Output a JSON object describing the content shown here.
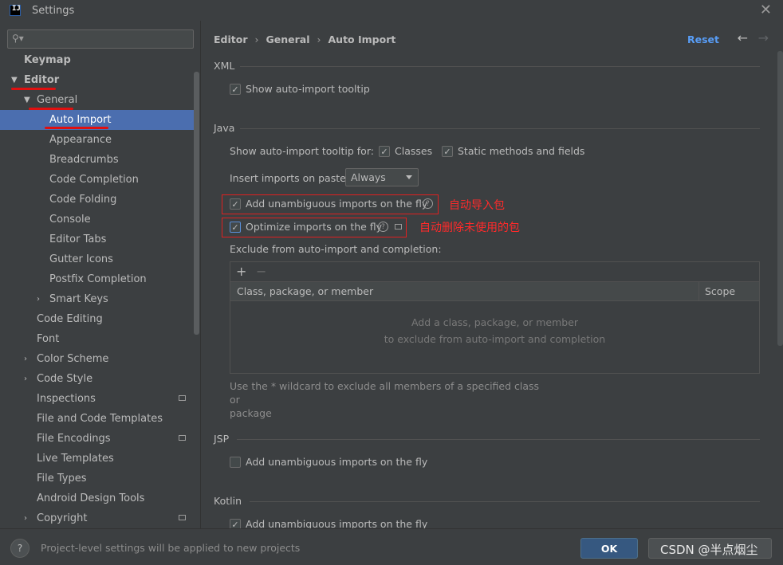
{
  "window": {
    "title": "Settings",
    "app_icon_text": "IJ"
  },
  "sidebar": {
    "search_placeholder": "",
    "items": [
      {
        "label": "Keymap"
      },
      {
        "label": "Editor"
      },
      {
        "label": "General"
      },
      {
        "label": "Auto Import"
      },
      {
        "label": "Appearance"
      },
      {
        "label": "Breadcrumbs"
      },
      {
        "label": "Code Completion"
      },
      {
        "label": "Code Folding"
      },
      {
        "label": "Console"
      },
      {
        "label": "Editor Tabs"
      },
      {
        "label": "Gutter Icons"
      },
      {
        "label": "Postfix Completion"
      },
      {
        "label": "Smart Keys"
      },
      {
        "label": "Code Editing"
      },
      {
        "label": "Font"
      },
      {
        "label": "Color Scheme"
      },
      {
        "label": "Code Style"
      },
      {
        "label": "Inspections"
      },
      {
        "label": "File and Code Templates"
      },
      {
        "label": "File Encodings"
      },
      {
        "label": "Live Templates"
      },
      {
        "label": "File Types"
      },
      {
        "label": "Android Design Tools"
      },
      {
        "label": "Copyright"
      }
    ]
  },
  "header": {
    "breadcrumb": [
      "Editor",
      "General",
      "Auto Import"
    ],
    "reset_label": "Reset"
  },
  "xml": {
    "title": "XML",
    "show_tooltip_label": "Show auto-import tooltip"
  },
  "java": {
    "title": "Java",
    "show_tooltip_for_label": "Show auto-import tooltip for:",
    "classes_label": "Classes",
    "static_label": "Static methods and fields",
    "insert_on_paste_label": "Insert imports on paste:",
    "insert_on_paste_value": "Always",
    "add_unambiguous_label": "Add unambiguous imports on the fly",
    "optimize_label": "Optimize imports on the fly",
    "exclude_label": "Exclude from auto-import and completion:",
    "table": {
      "columns": [
        "Class, package, or member",
        "Scope"
      ],
      "empty_line1": "Add a class, package, or member",
      "empty_line2": "to exclude from auto-import and completion"
    },
    "hint_line1": "Use the * wildcard to exclude all members of a specified class or",
    "hint_line2": "package"
  },
  "annotations": {
    "auto_import": "自动导入包",
    "auto_remove": "自动删除未使用的包"
  },
  "jsp": {
    "title": "JSP",
    "add_unambiguous_label": "Add unambiguous imports on the fly"
  },
  "kotlin": {
    "title": "Kotlin",
    "add_unambiguous_label": "Add unambiguous imports on the fly"
  },
  "footer": {
    "note": "Project-level settings will be applied to new projects",
    "ok_label": "OK",
    "watermark": "CSDN @半点烟尘"
  },
  "checked_glyph": "✓",
  "help_glyph": "?",
  "colors": {
    "accent": "#4b6eaf",
    "link": "#589df6",
    "annotation_red": "#ff2a2a"
  }
}
